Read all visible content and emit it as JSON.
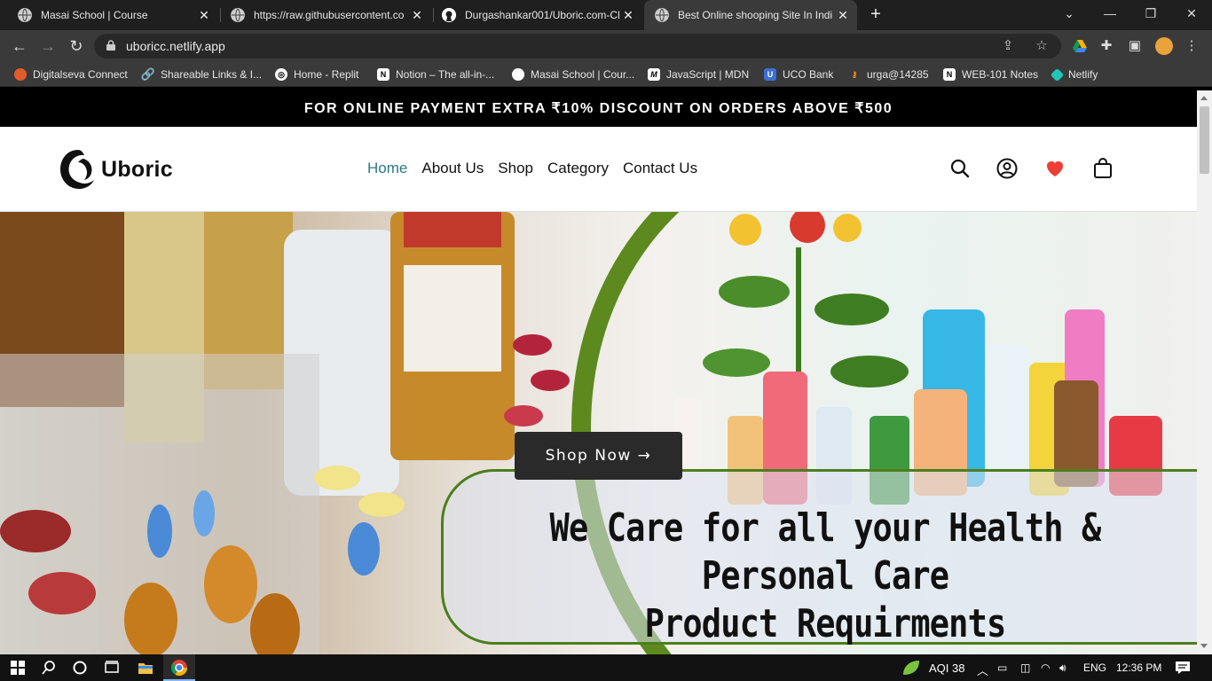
{
  "browser": {
    "tabs": [
      {
        "title": "Masai School | Course",
        "favicon": "globe-icon"
      },
      {
        "title": "https://raw.githubusercontent.co",
        "favicon": "globe-icon"
      },
      {
        "title": "Durgashankar001/Uboric.com-Cl",
        "favicon": "github-icon"
      },
      {
        "title": "Best Online shooping Site In Indi",
        "favicon": "globe-icon"
      }
    ],
    "tab_close_glyph": "✕",
    "new_tab_glyph": "+",
    "url": "uboricc.netlify.app",
    "bookmarks": [
      {
        "label": "Digitalseva Connect",
        "icon": "digitalseva-icon",
        "color": "#e25b2b"
      },
      {
        "label": "Shareable Links & I...",
        "icon": "link-icon",
        "color": "#cccccc"
      },
      {
        "label": "Home - Replit",
        "icon": "replit-icon",
        "color": "#ffffff"
      },
      {
        "label": "Notion – The all-in-...",
        "icon": "notion-icon",
        "color": "#ffffff"
      },
      {
        "label": "Masai School | Cour...",
        "icon": "globe-icon",
        "color": "#ffffff"
      },
      {
        "label": "JavaScript | MDN",
        "icon": "mdn-icon",
        "color": "#ffffff"
      },
      {
        "label": "UCO Bank",
        "icon": "uco-icon",
        "color": "#3b6fd6"
      },
      {
        "label": "urga@14285",
        "icon": "key-icon",
        "color": "#f39c12"
      },
      {
        "label": "WEB-101 Notes",
        "icon": "notion-icon",
        "color": "#ffffff"
      },
      {
        "label": "Netlify",
        "icon": "netlify-icon",
        "color": "#20c6b7"
      }
    ]
  },
  "site": {
    "promo": "FOR ONLINE PAYMENT EXTRA ₹10% DISCOUNT ON ORDERS ABOVE ₹500",
    "brand": "Uboric",
    "menu": [
      {
        "label": "Home",
        "active": true
      },
      {
        "label": "About Us",
        "active": false
      },
      {
        "label": "Shop",
        "active": false
      },
      {
        "label": "Category",
        "active": false
      },
      {
        "label": "Contact Us",
        "active": false
      }
    ],
    "accent_color": "#2b7a83",
    "heart_color": "#ef3e36",
    "hero": {
      "cta": "Shop Now →",
      "caption_line1": "We Care for all your Health & Personal Care",
      "caption_line2": "Product Requirments",
      "frame_color": "#4c7e1d"
    }
  },
  "taskbar": {
    "aqi": "AQI 38",
    "language": "ENG",
    "time": "12:36 PM"
  }
}
